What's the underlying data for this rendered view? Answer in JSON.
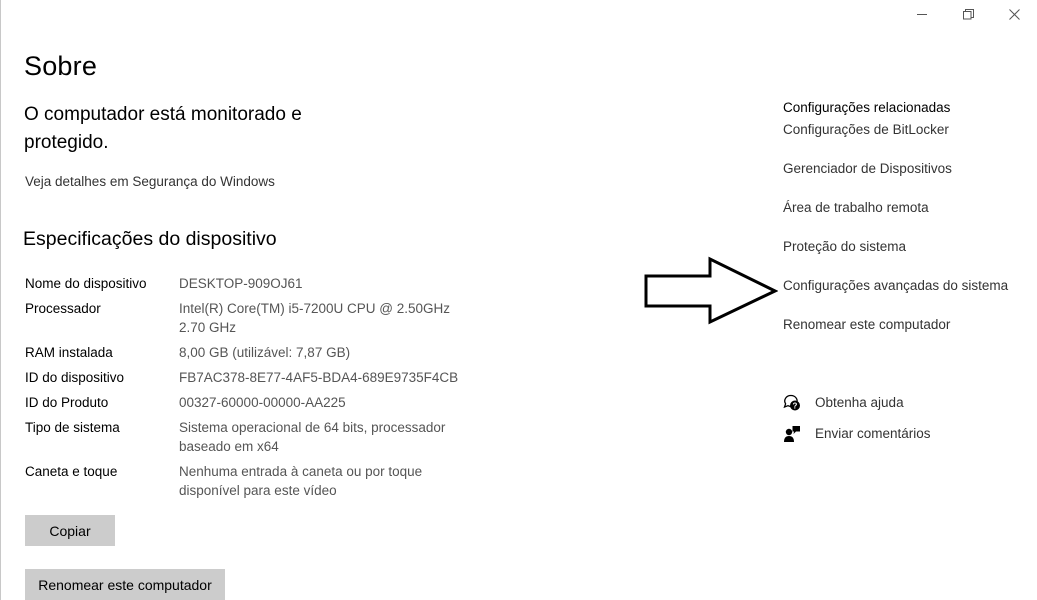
{
  "window": {
    "controls": {
      "minimize_icon": "minimize-icon",
      "restore_icon": "restore-icon",
      "close_icon": "close-icon"
    }
  },
  "page": {
    "title": "Sobre",
    "protection_heading": "O computador está monitorado e protegido.",
    "security_link": "Veja detalhes em Segurança do Windows",
    "specs_heading": "Especificações do dispositivo"
  },
  "specs": [
    {
      "label": "Nome do dispositivo",
      "value": "DESKTOP-909OJ61"
    },
    {
      "label": "Processador",
      "value": "Intel(R) Core(TM) i5-7200U CPU @ 2.50GHz 2.70 GHz"
    },
    {
      "label": "RAM instalada",
      "value": "8,00 GB (utilizável: 7,87 GB)"
    },
    {
      "label": "ID do dispositivo",
      "value": "FB7AC378-8E77-4AF5-BDA4-689E9735F4CB"
    },
    {
      "label": "ID do Produto",
      "value": "00327-60000-00000-AA225"
    },
    {
      "label": "Tipo de sistema",
      "value": "Sistema operacional de 64 bits, processador baseado em x64"
    },
    {
      "label": "Caneta e toque",
      "value": "Nenhuma entrada à caneta ou por toque disponível para este vídeo"
    }
  ],
  "buttons": {
    "copy": "Copiar",
    "rename": "Renomear este computador"
  },
  "related": {
    "title": "Configurações relacionadas",
    "links": [
      "Configurações de BitLocker",
      "Gerenciador de Dispositivos",
      "Área de trabalho remota",
      "Proteção do sistema",
      "Configurações avançadas do sistema",
      "Renomear este computador"
    ]
  },
  "help": {
    "get_help": "Obtenha ajuda",
    "feedback": "Enviar comentários"
  },
  "annotation": {
    "arrow_icon": "arrow-right-icon",
    "points_to": "Configurações avançadas do sistema"
  }
}
